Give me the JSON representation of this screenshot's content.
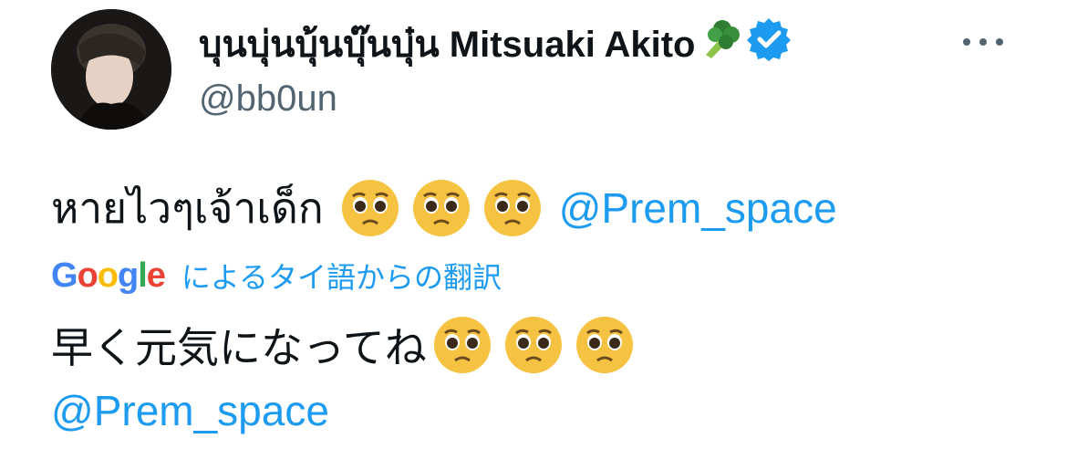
{
  "user": {
    "display_name": "บุนบุ่นบุ้นบุ๊นบุ๋น Mitsuaki Akito",
    "handle": "@bb0un",
    "badge_emoji": "broccoli",
    "verified_icon": "verified-badge"
  },
  "tweet": {
    "original_text": "หายไวๆเจ้าเด็ก",
    "original_mention": "@Prem_space",
    "translation_provider": "Google",
    "translation_note": "によるタイ語からの翻訳",
    "translated_text": "早く元気になってね",
    "translated_mention": "@Prem_space",
    "emoji": "pleading-face"
  },
  "colors": {
    "link": "#1d9bf0",
    "secondary_text": "#536471",
    "verified": "#1d9bf0"
  }
}
